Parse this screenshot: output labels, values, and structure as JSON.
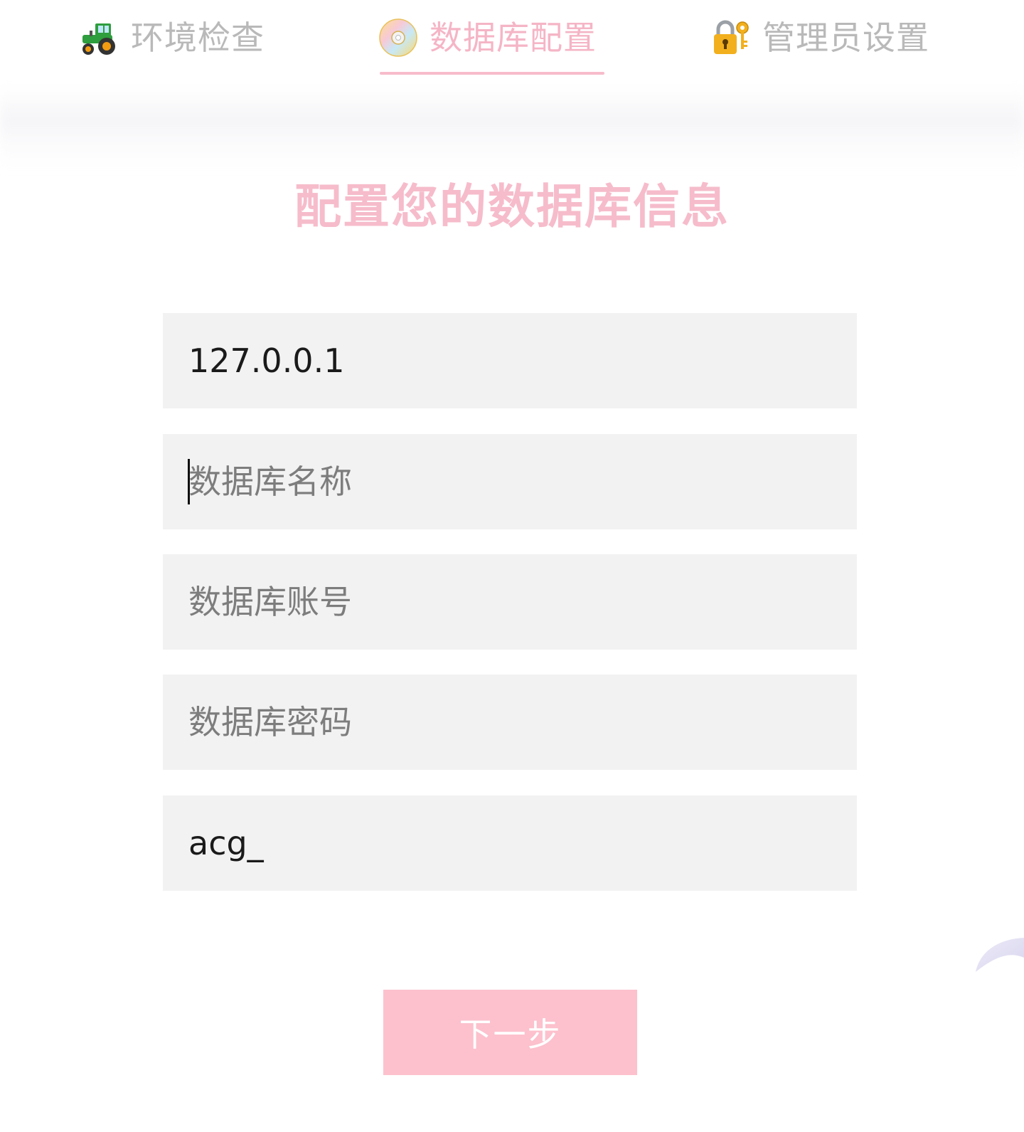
{
  "tabs": [
    {
      "label": "环境检查",
      "icon": "tractor-icon",
      "active": false
    },
    {
      "label": "数据库配置",
      "icon": "cd-disc-icon",
      "active": true
    },
    {
      "label": "管理员设置",
      "icon": "lock-with-key-icon",
      "active": false
    }
  ],
  "heading": "配置您的数据库信息",
  "form": {
    "host": {
      "value": "127.0.0.1",
      "placeholder": ""
    },
    "db_name": {
      "value": "",
      "placeholder": "数据库名称"
    },
    "db_user": {
      "value": "",
      "placeholder": "数据库账号"
    },
    "db_pass": {
      "value": "",
      "placeholder": "数据库密码"
    },
    "prefix": {
      "value": "acg_",
      "placeholder": ""
    }
  },
  "next_button": {
    "label": "下一步"
  },
  "colors": {
    "accent": "#f6bccb",
    "button_bg": "#fcc1cd",
    "input_bg": "#f2f2f2",
    "inactive_tab": "#b9b9b9",
    "placeholder": "#7d7d7d"
  }
}
